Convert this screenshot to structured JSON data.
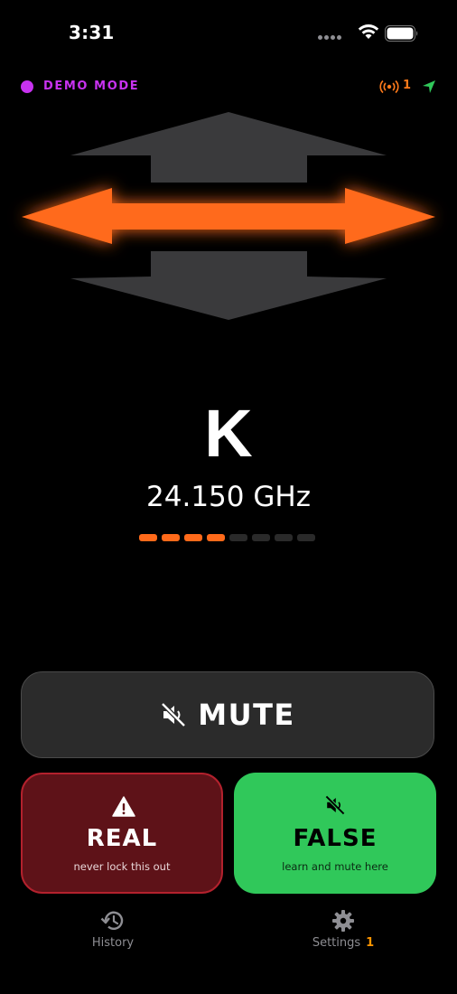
{
  "status_bar": {
    "time": "3:31"
  },
  "header": {
    "mode_label": "DEMO MODE",
    "signal_count": "1",
    "colors": {
      "demo": "#c832f0",
      "signal": "#ff7a1a",
      "location": "#30c85a"
    }
  },
  "alert": {
    "direction_icon": "side-arrows-active",
    "band": "K",
    "frequency": "24.150 GHz",
    "strength_level": 4,
    "strength_total": 8,
    "colors": {
      "active": "#ff6a1a",
      "inactive": "#2a2a2a",
      "arrow_idle": "#3a3a3c"
    }
  },
  "actions": {
    "mute_label": "MUTE",
    "mute_icon": "speaker-muted-icon",
    "real": {
      "title": "REAL",
      "subtitle": "never lock this out",
      "icon": "warning-icon"
    },
    "false": {
      "title": "FALSE",
      "subtitle": "learn and mute here",
      "icon": "speaker-muted-icon"
    }
  },
  "tabs": [
    {
      "label": "History",
      "icon": "history-icon"
    },
    {
      "label": "Settings",
      "icon": "gear-icon",
      "badge": "1"
    }
  ]
}
